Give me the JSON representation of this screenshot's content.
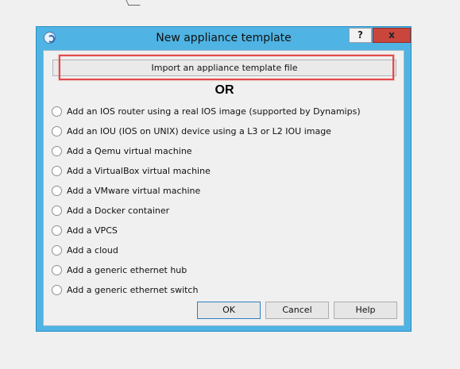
{
  "window": {
    "title": "New appliance template",
    "help_label": "?",
    "close_label": "x"
  },
  "import_button": {
    "label": "Import an appliance template file"
  },
  "separator": {
    "label": "OR"
  },
  "options": [
    {
      "label": "Add an IOS router using a real IOS image (supported by Dynamips)",
      "selected": false
    },
    {
      "label": "Add an IOU (IOS on UNIX) device using a L3 or L2 IOU image",
      "selected": false
    },
    {
      "label": "Add a Qemu virtual machine",
      "selected": false
    },
    {
      "label": "Add a VirtualBox virtual machine",
      "selected": false
    },
    {
      "label": "Add a VMware virtual machine",
      "selected": false
    },
    {
      "label": "Add a Docker container",
      "selected": false
    },
    {
      "label": "Add a VPCS",
      "selected": false
    },
    {
      "label": "Add a cloud",
      "selected": false
    },
    {
      "label": "Add a generic ethernet hub",
      "selected": false
    },
    {
      "label": "Add a generic ethernet switch",
      "selected": false
    }
  ],
  "buttons": {
    "ok_label": "OK",
    "cancel_label": "Cancel",
    "help_label": "Help"
  },
  "colors": {
    "window_frame": "#4fb3e3",
    "close_button": "#c9463d",
    "highlight": "#e34a49"
  }
}
